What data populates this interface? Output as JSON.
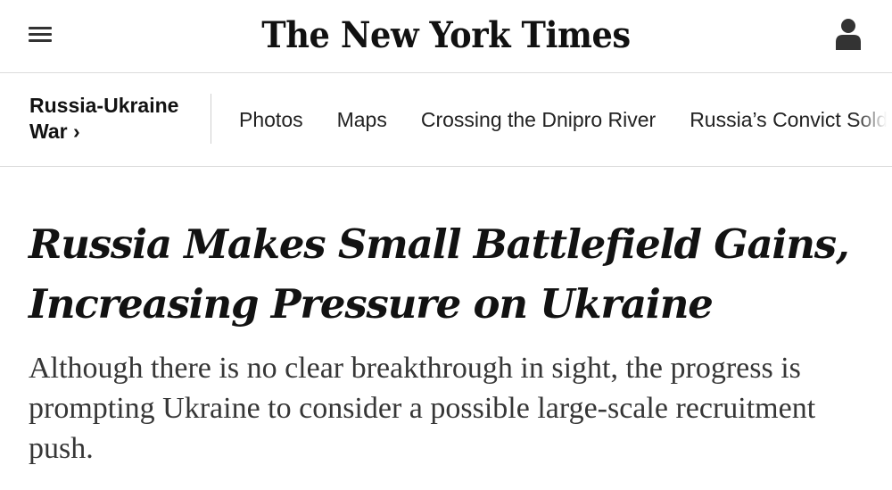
{
  "header": {
    "masthead": "The New York Times",
    "menu_icon": "hamburger-menu-icon",
    "account_icon": "user-account-icon"
  },
  "section_nav": {
    "title": "Russia-Ukraine War ›",
    "links": [
      "Photos",
      "Maps",
      "Crossing the Dnipro River",
      "Russia’s Convict Soldiers"
    ]
  },
  "article": {
    "headline": "Russia Makes Small Battlefield Gains, Increasing Pressure on Ukraine",
    "summary": "Although there is no clear breakthrough in sight, the progress is prompting Ukraine to consider a possible large-scale recruitment push."
  },
  "colors": {
    "text": "#121212",
    "summary_text": "#363636",
    "divider": "#dcdcdc"
  }
}
